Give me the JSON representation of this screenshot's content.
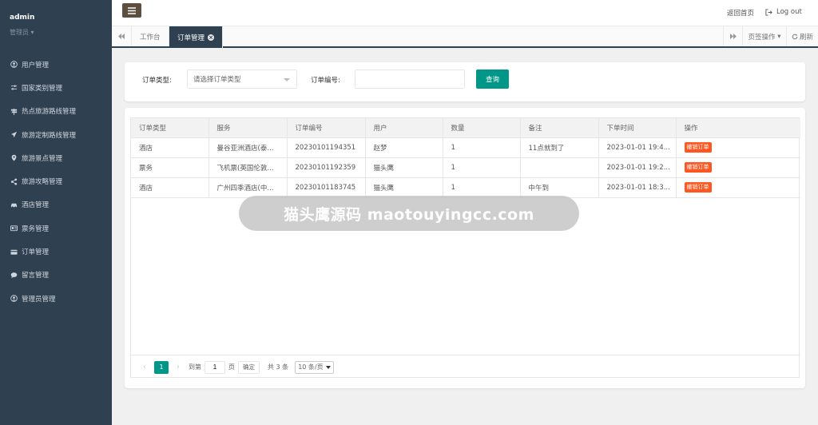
{
  "sidebar": {
    "user": "admin",
    "role": "管理员",
    "items": [
      {
        "label": "用户管理",
        "icon": "user-circle-icon"
      },
      {
        "label": "国家类别管理",
        "icon": "sliders-icon"
      },
      {
        "label": "热点旅游路线管理",
        "icon": "signpost-icon"
      },
      {
        "label": "旅游定制路线管理",
        "icon": "paper-plane-icon"
      },
      {
        "label": "旅游景点管理",
        "icon": "map-marker-icon"
      },
      {
        "label": "旅游攻略管理",
        "icon": "share-icon"
      },
      {
        "label": "酒店管理",
        "icon": "car-icon"
      },
      {
        "label": "票务管理",
        "icon": "id-card-icon"
      },
      {
        "label": "订单管理",
        "icon": "credit-card-icon"
      },
      {
        "label": "留言管理",
        "icon": "comment-icon"
      },
      {
        "label": "管理员管理",
        "icon": "user-icon"
      }
    ]
  },
  "topbar": {
    "home": "返回首页",
    "logout": "Log out"
  },
  "tabs": {
    "workbench": "工作台",
    "active": "订单管理",
    "ops": "页签操作",
    "refresh": "刷新"
  },
  "filter": {
    "type_label": "订单类型:",
    "type_placeholder": "请选择订单类型",
    "number_label": "订单编号:",
    "search_btn": "查询"
  },
  "table": {
    "columns": [
      "订单类型",
      "服务",
      "订单编号",
      "用户",
      "数量",
      "备注",
      "下单时间",
      "操作"
    ],
    "rows": [
      {
        "type": "酒店",
        "service": "曼谷亚洲酒店(泰...",
        "number": "20230101194351",
        "user": "赵梦",
        "qty": "1",
        "note": "11点就到了",
        "time": "2023-01-01 19:4...",
        "action": "撤销订单"
      },
      {
        "type": "票务",
        "service": "飞机票(英国伦敦...",
        "number": "20230101192359",
        "user": "猫头鹰",
        "qty": "1",
        "note": "",
        "time": "2023-01-01 19:2...",
        "action": "撤销订单"
      },
      {
        "type": "酒店",
        "service": "广州四季酒店(中...",
        "number": "20230101183745",
        "user": "猫头鹰",
        "qty": "1",
        "note": "中午到",
        "time": "2023-01-01 18:3...",
        "action": "撤销订单"
      }
    ]
  },
  "pager": {
    "current": "1",
    "goto_label": "到第",
    "page_value": "1",
    "page_unit": "页",
    "confirm": "确定",
    "total": "共 3 条",
    "page_size": "10 条/页"
  },
  "watermark": "猫头鹰源码 maotouyingcc.com",
  "colors": {
    "sidebar": "#2f4050",
    "accent": "#009688",
    "danger": "#ff5722"
  }
}
